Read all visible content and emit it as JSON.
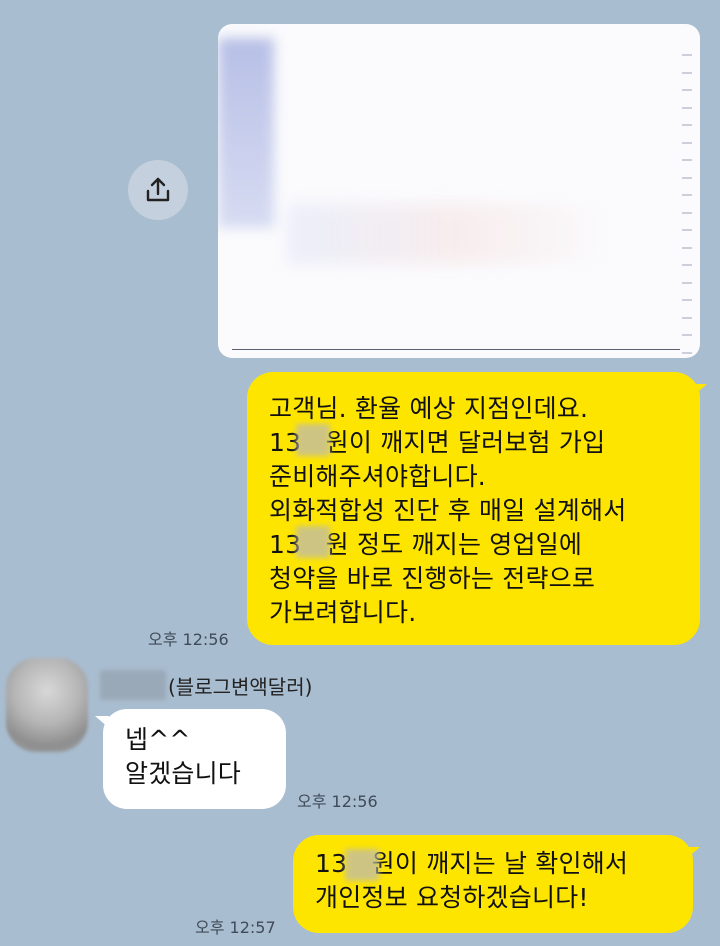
{
  "chat": {
    "shared_image": {
      "type": "blurred-chart-image"
    },
    "messages": [
      {
        "from": "me",
        "lines": [
          "고객님. 환율 예상 지점인데요.",
          "13   원이 깨지면 달러보험 가입",
          "준비해주셔야합니다.",
          "외화적합성 진단 후 매일 설계해서",
          "13   원 정도 깨지는 영업일에",
          "청약을 바로 진행하는 전략으로",
          "가보려합니다."
        ],
        "time": "오후 12:56"
      },
      {
        "from": "other",
        "sender": "(블로그변액달러)",
        "lines": [
          "넵^^",
          "알겠습니다"
        ],
        "time": "오후 12:56"
      },
      {
        "from": "me",
        "lines": [
          "13   원이 깨지는 날 확인해서",
          "개인정보 요청하겠습니다!"
        ],
        "time": "오후 12:57"
      }
    ]
  },
  "colors": {
    "background": "#a9bdd0",
    "my_bubble": "#fee500",
    "their_bubble": "#ffffff"
  },
  "icons": {
    "share": "share-upload-icon"
  }
}
